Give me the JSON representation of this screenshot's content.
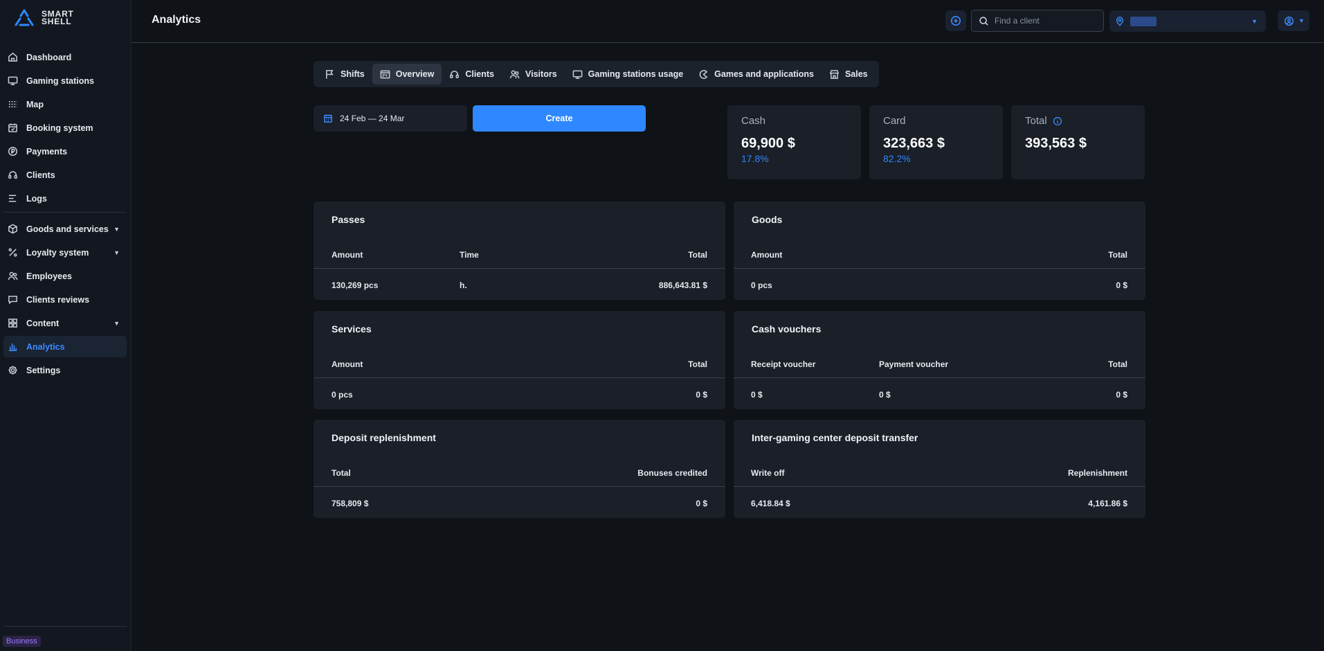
{
  "brand": {
    "line1": "SMART",
    "line2": "SHELL"
  },
  "header": {
    "title": "Analytics",
    "search_placeholder": "Find a client"
  },
  "sidebar": {
    "items": [
      {
        "label": "Dashboard"
      },
      {
        "label": "Gaming stations"
      },
      {
        "label": "Map"
      },
      {
        "label": "Booking system"
      },
      {
        "label": "Payments"
      },
      {
        "label": "Clients"
      },
      {
        "label": "Logs"
      },
      {
        "label": "Goods and services"
      },
      {
        "label": "Loyalty system"
      },
      {
        "label": "Employees"
      },
      {
        "label": "Clients reviews"
      },
      {
        "label": "Content"
      },
      {
        "label": "Analytics"
      },
      {
        "label": "Settings"
      }
    ],
    "plan_badge": "Business"
  },
  "tabs": [
    {
      "label": "Shifts"
    },
    {
      "label": "Overview"
    },
    {
      "label": "Clients"
    },
    {
      "label": "Visitors"
    },
    {
      "label": "Gaming stations usage"
    },
    {
      "label": "Games and applications"
    },
    {
      "label": "Sales"
    }
  ],
  "filters": {
    "date_range": "24 Feb — 24 Mar",
    "create_label": "Create"
  },
  "summary": {
    "cash": {
      "label": "Cash",
      "value": "69,900 $",
      "pct": "17.8%"
    },
    "card": {
      "label": "Card",
      "value": "323,663 $",
      "pct": "82.2%"
    },
    "total": {
      "label": "Total",
      "value": "393,563 $"
    }
  },
  "panels": {
    "passes": {
      "title": "Passes",
      "headers": [
        "Amount",
        "Time",
        "Total"
      ],
      "row": [
        "130,269 pcs",
        "h.",
        "886,643.81 $"
      ]
    },
    "goods": {
      "title": "Goods",
      "headers": [
        "Amount",
        "Total"
      ],
      "row": [
        "0 pcs",
        "0 $"
      ]
    },
    "services": {
      "title": "Services",
      "headers": [
        "Amount",
        "Total"
      ],
      "row": [
        "0 pcs",
        "0 $"
      ]
    },
    "vouchers": {
      "title": "Cash vouchers",
      "headers": [
        "Receipt voucher",
        "Payment voucher",
        "Total"
      ],
      "row": [
        "0 $",
        "0 $",
        "0 $"
      ]
    },
    "deposit": {
      "title": "Deposit replenishment",
      "headers": [
        "Total",
        "Bonuses credited"
      ],
      "row": [
        "758,809 $",
        "0 $"
      ]
    },
    "transfer": {
      "title": "Inter-gaming center deposit transfer",
      "headers": [
        "Write off",
        "Replenishment"
      ],
      "row": [
        "6,418.84 $",
        "4,161.86 $"
      ]
    }
  },
  "colors": {
    "accent": "#2f88ff",
    "background": "#0f1217",
    "panel": "#1a1f28",
    "badge": "#9a7bff"
  }
}
